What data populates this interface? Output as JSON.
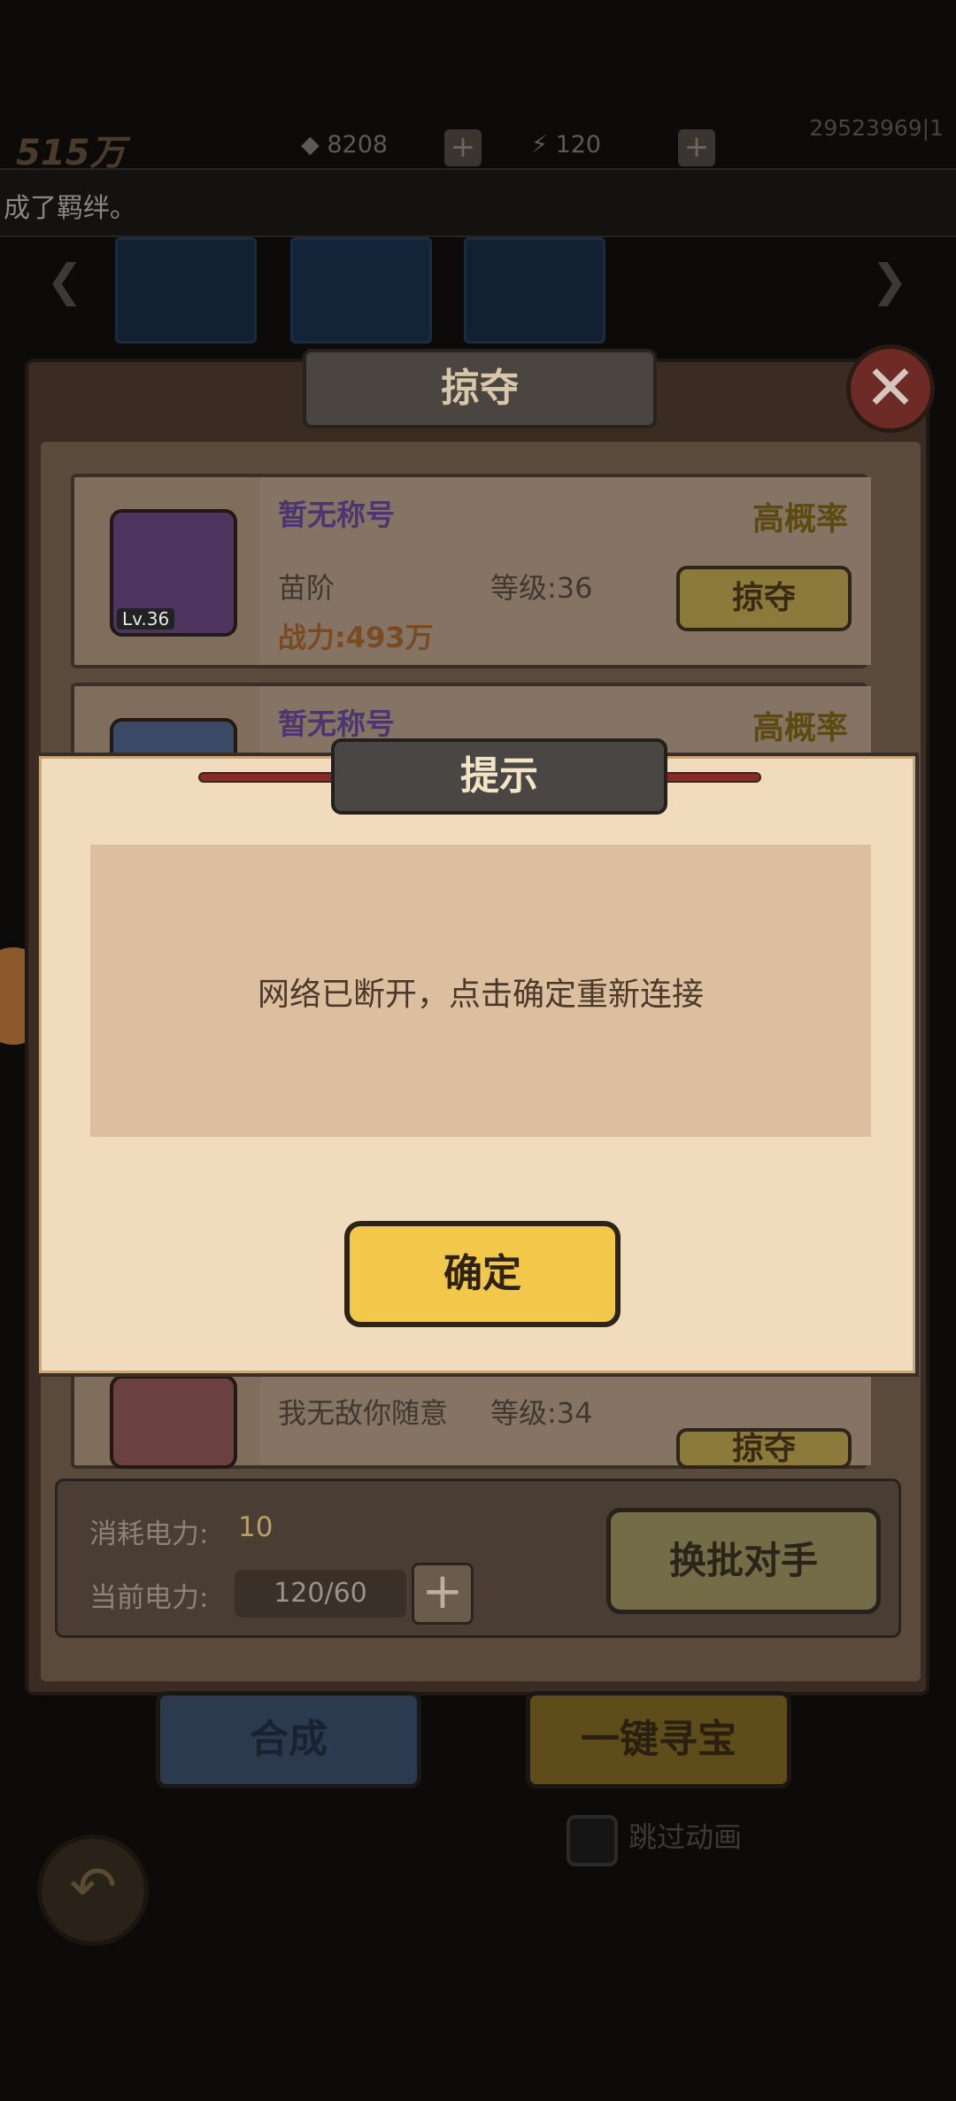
{
  "topbar": {
    "power": "515万",
    "diamonds": "8208",
    "energy": "120",
    "uid": "29523969|1"
  },
  "ticker": {
    "text": "成了羁绊。"
  },
  "panel": {
    "title": "掠夺",
    "cards": [
      {
        "title": "暂无称号",
        "rank": "苗阶",
        "level": "等级:36",
        "power": "战力:493万",
        "probability": "高概率",
        "button": "掠夺",
        "avatar_level": "Lv.36"
      },
      {
        "title": "暂无称号",
        "probability": "高概率"
      },
      {
        "rank": "我无敌你随意",
        "level": "等级:34",
        "button": "掠夺"
      }
    ],
    "cost_label": "消耗电力:",
    "cost_value": "10",
    "current_label": "当前电力:",
    "current_value": "120/60",
    "swap_button": "换批对手"
  },
  "below": {
    "compose": "合成",
    "treasure": "一键寻宝",
    "skip": "跳过动画"
  },
  "modal": {
    "title": "提示",
    "message": "网络已断开，点击确定重新连接",
    "ok": "确定"
  },
  "colors": {
    "modal_bg": "#f0dbbd",
    "ok_button": "#f2c84a",
    "title_purple": "#4b3572"
  }
}
